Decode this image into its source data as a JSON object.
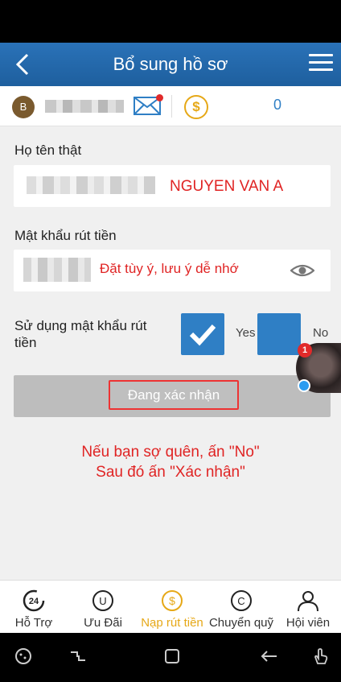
{
  "header": {
    "title": "Bổ sung hồ sơ"
  },
  "user": {
    "avatar_letter": "B",
    "balance": "0"
  },
  "form": {
    "name_label": "Họ tên thật",
    "name_note": "NGUYEN VAN A",
    "password_label": "Mật khẩu rút tiền",
    "password_note": "Đặt tùy ý, lưu ý dễ nhớ",
    "use_password_label": "Sử dụng mật khẩu rút tiền",
    "yes_label": "Yes",
    "no_label": "No",
    "submit_label": "Đang xác nhận"
  },
  "chat": {
    "badge": "1"
  },
  "instruction": {
    "line1": "Nếu bạn sợ quên, ấn \"No\"",
    "line2": "Sau đó ấn \"Xác nhận\""
  },
  "tabs": [
    {
      "label": "Hỗ Trợ",
      "icon": "support-24-icon"
    },
    {
      "label": "Ưu Đãi",
      "icon": "promo-icon"
    },
    {
      "label": "Nạp rút tiền",
      "icon": "dollar-icon",
      "active": true
    },
    {
      "label": "Chuyển quỹ",
      "icon": "transfer-icon"
    },
    {
      "label": "Hội viên",
      "icon": "member-icon"
    }
  ],
  "colors": {
    "header": "#1e5f9e",
    "accent": "#2f7fc5",
    "active_tab": "#e6a817",
    "note_red": "#e02424"
  }
}
